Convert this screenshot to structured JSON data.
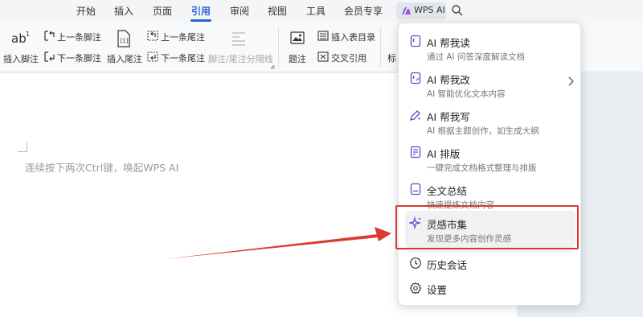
{
  "menubar": {
    "tabs": [
      "开始",
      "插入",
      "页面",
      "引用",
      "审阅",
      "视图",
      "工具",
      "会员专享"
    ],
    "active_tab": "引用",
    "wps_ai_label": "WPS AI"
  },
  "ribbon": {
    "insert_footnote": "插入脚注",
    "prev_footnote": "上一条脚注",
    "next_footnote": "下一条脚注",
    "insert_endnote": "插入尾注",
    "prev_endnote": "上一条尾注",
    "next_endnote": "下一条尾注",
    "separator_line": "脚注/尾注分隔线",
    "caption": "题注",
    "insert_table_of_figures": "插入表目录",
    "cross_reference": "交叉引用",
    "cut_label": "标"
  },
  "document": {
    "placeholder": "连续按下两次Ctrl键，唤起WPS AI"
  },
  "ai_menu": {
    "items": [
      {
        "title": "AI 帮我读",
        "subtitle": "通过 AI 问答深度解读文档",
        "icon": "doc-read-icon"
      },
      {
        "title": "AI 帮我改",
        "subtitle": "AI 智能优化文本内容",
        "icon": "doc-edit-icon",
        "has_submenu": true
      },
      {
        "title": "AI 帮我写",
        "subtitle": "AI 根据主题创作，如生成大纲",
        "icon": "pen-sparkle-icon"
      },
      {
        "title": "AI 排版",
        "subtitle": "一键完成文档格式整理与排版",
        "icon": "layout-icon"
      },
      {
        "title": "全文总结",
        "subtitle": "快速提炼文档内容",
        "icon": "summary-icon"
      },
      {
        "title": "灵感市集",
        "subtitle": "发现更多内容创作灵感",
        "icon": "sparkle-icon",
        "highlighted": true
      }
    ],
    "history": "历史会话",
    "settings": "设置"
  },
  "colors": {
    "accent": "#2b63d9",
    "ai_purple": "#6b45c9",
    "annotation_red": "#d93a2f"
  }
}
